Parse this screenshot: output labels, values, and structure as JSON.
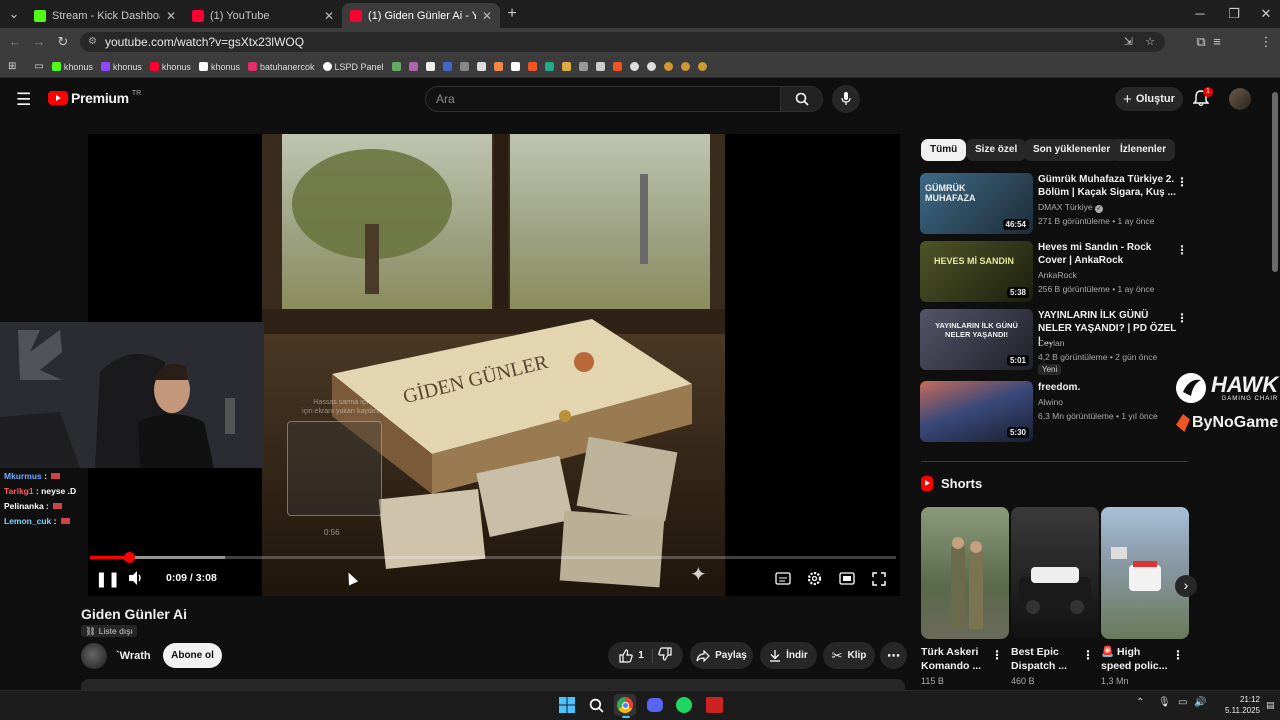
{
  "browser": {
    "tabs": [
      {
        "label": "Stream - Kick Dashboard",
        "favicon_color": "#53fc18"
      },
      {
        "label": "(1) YouTube",
        "favicon_color": "#ff0033"
      },
      {
        "label": "(1) Giden Günler Ai - YouTu",
        "favicon_color": "#ff0033"
      }
    ],
    "url": "youtube.com/watch?v=gsXtx23lWOQ",
    "bookmarks": [
      {
        "label": "khonus",
        "icon_color": "#53fc18"
      },
      {
        "label": "khonus",
        "icon_color": "#9146ff"
      },
      {
        "label": "khonus",
        "icon_color": "#ff0033"
      },
      {
        "label": "khonus",
        "icon_color": "#ffffff"
      },
      {
        "label": "batuhanercok",
        "icon_color": "#e1306c"
      },
      {
        "label": "LSPD Panel",
        "icon_color": "#ffffff"
      }
    ]
  },
  "youtube": {
    "logo_text": "Premium",
    "logo_region": "TR",
    "search_placeholder": "Ara",
    "create_label": "Oluştur",
    "notification_count": "1",
    "chips": [
      "Tümü",
      "Size özel",
      "Son yüklenenler",
      "İzlenenler"
    ]
  },
  "player": {
    "art_title": "GİDEN GÜNLER",
    "time_current": "0:09",
    "time_sep": " / ",
    "time_total": "3:08",
    "played_fraction": 0.048,
    "buffered_fraction": 0.168,
    "preview_tip_line1": "Hassas sarma için",
    "preview_tip_line2": "için ekranı yukarı kaydırın",
    "preview_time": "0:56"
  },
  "video": {
    "title": "Giden Günler Ai",
    "visibility": "Liste dışı",
    "channel": "`Wrath",
    "subscribe_label": "Abone ol",
    "likes": "1",
    "share_label": "Paylaş",
    "download_label": "İndir",
    "clip_label": "Klip"
  },
  "stream_overlay": {
    "chat": [
      {
        "user": "Mkurmus",
        "message": "",
        "user_color": "#6fa8ff"
      },
      {
        "user": "Tarikg1",
        "message": "neyse .D",
        "user_color": "#ff5a5a"
      },
      {
        "user": "Pelinanka",
        "message": "",
        "user_color": "#ffffff"
      },
      {
        "user": "Lemon_cuk",
        "message": "",
        "user_color": "#7fd4ff"
      }
    ],
    "sponsor1": "HAWK",
    "sponsor1_sub": "GAMING CHAIR",
    "sponsor2": "ByNoGame"
  },
  "recommended": [
    {
      "title": "Gümrük Muhafaza Türkiye 2. Bölüm | Kaçak Sigara, Kuş ...",
      "channel": "DMAX Türkiye",
      "verified": true,
      "views": "271 B görüntüleme",
      "age": "1 ay önce",
      "duration": "46:54",
      "badge": "",
      "thumb_color": "#2d4a5e",
      "thumb_text": "GÜMRÜK MUHAFAZA"
    },
    {
      "title": "Heves mi Sandın - Rock Cover | AnkaRock",
      "channel": "AnkaRock",
      "verified": false,
      "views": "256 B görüntüleme",
      "age": "1 ay önce",
      "duration": "5:38",
      "badge": "",
      "thumb_color": "#3a3f1f",
      "thumb_text": "HEVES Mİ SANDIN"
    },
    {
      "title": "YAYINLARIN İLK GÜNÜ NELER YAŞANDI? | PD ÖZEL | ...",
      "channel": "Ceylan",
      "verified": false,
      "views": "4,2 B görüntüleme",
      "age": "2 gün önce",
      "duration": "5:01",
      "badge": "Yeni",
      "thumb_color": "#3a3a44",
      "thumb_text": "YAYINLARIN İLK GÜNÜ NELER YAŞANDI!"
    },
    {
      "title": "freedom.",
      "channel": "Alwino",
      "verified": false,
      "views": "6,3 Mn görüntüleme",
      "age": "1 yıl önce",
      "duration": "5:30",
      "badge": "",
      "thumb_color": "#4a5a7a",
      "thumb_text": ""
    }
  ],
  "shorts": {
    "heading": "Shorts",
    "items": [
      {
        "title": "Türk Askeri Komando ...",
        "views": "115 B",
        "thumb_color": "#6b7a5a"
      },
      {
        "title": "Best Epic Dispatch ...",
        "views": "460 B",
        "thumb_color": "#2a2a2a"
      },
      {
        "title": "🚨 High speed polic...",
        "views": "1,3 Mn",
        "thumb_color": "#7a8ea8"
      }
    ]
  },
  "taskbar": {
    "time": "21:12",
    "date": "5.11.2025"
  }
}
